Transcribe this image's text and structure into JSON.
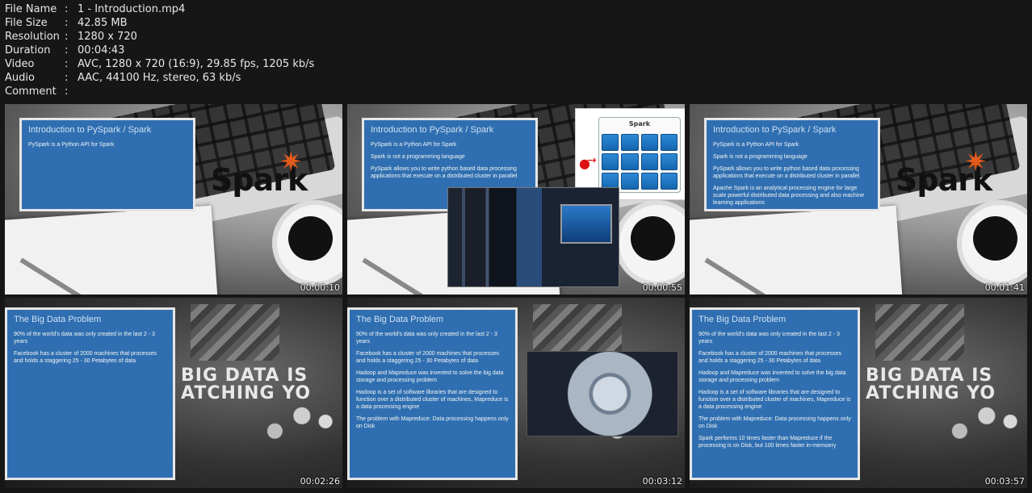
{
  "file_info": {
    "rows": [
      {
        "key": "File Name",
        "value": "1 - Introduction.mp4"
      },
      {
        "key": "File Size",
        "value": "42.85 MB"
      },
      {
        "key": "Resolution",
        "value": "1280 x 720"
      },
      {
        "key": "Duration",
        "value": "00:04:43"
      },
      {
        "key": "Video",
        "value": "AVC, 1280 x 720 (16:9), 29.85 fps, 1205 kb/s"
      },
      {
        "key": "Audio",
        "value": "AAC, 44100 Hz, stereo, 63 kb/s"
      },
      {
        "key": "Comment",
        "value": ""
      }
    ],
    "separator": ":"
  },
  "thumbnails": [
    {
      "timestamp": "00:00:10",
      "slide_title": "Introduction to PySpark / Spark",
      "lines": [
        "PySpark is a Python API for Spark"
      ],
      "logo_text": "Spark"
    },
    {
      "timestamp": "00:00:55",
      "slide_title": "Introduction to PySpark / Spark",
      "lines": [
        "PySpark is a Python API for Spark",
        "Spark is not a programming language",
        "PySpark allows you to write python based data processing applications that execute on a distributed cluster in parallel"
      ],
      "cluster_label": "Spark"
    },
    {
      "timestamp": "00:01:41",
      "slide_title": "Introduction to PySpark / Spark",
      "lines": [
        "PySpark is a Python API for Spark",
        "Spark is not a programming language",
        "PySpark allows you to write python based data processing applications that execute on a distributed cluster in parallel",
        "Apache Spark is an analytical processing engine for large scale powerful distributed data processing and also machine learning applications"
      ],
      "logo_text": "Spark"
    },
    {
      "timestamp": "00:02:26",
      "slide_title": "The Big Data Problem",
      "lines": [
        "90% of the world's data was only created in the last 2 - 3 years",
        "Facebook has a cluster of 2000 machines that processes and holds a staggering 25 - 30 Petabytes of data"
      ],
      "bg_text_1": "BIG DATA IS",
      "bg_text_2": "ATCHING YO"
    },
    {
      "timestamp": "00:03:12",
      "slide_title": "The Big Data Problem",
      "lines": [
        "90% of the world's data was only created in the last 2 - 3 years",
        "Facebook has a cluster of 2000 machines that processes and holds a staggering 25 - 30 Petabytes of data",
        "Hadoop and Mapreduce was invented to solve the big data storage and processing problem",
        "Hadoop is a set of software libraries that are designed to function over a distributed cluster of machines, Mapreduce is a data processing engine",
        "The problem with Mapreduce: Data processing happens only on Disk"
      ]
    },
    {
      "timestamp": "00:03:57",
      "slide_title": "The Big Data Problem",
      "lines": [
        "90% of the world's data was only created in the last 2 - 3 years",
        "Facebook has a cluster of 2000 machines that processes and holds a staggering 25 - 30 Petabytes of data",
        "Hadoop and Mapreduce was invented to solve the big data storage and processing problem",
        "Hadoop is a set of software libraries that are designed to function over a distributed cluster of machines, Mapreduce is a data processing engine",
        "The problem with Mapreduce: Data processing happens only on Disk",
        "Spark performs 10 times faster than Mapreduce if the processing is on Disk, but 100 times faster in-memoery"
      ],
      "bg_text_1": "BIG DATA IS",
      "bg_text_2": "ATCHING YO"
    }
  ],
  "colors": {
    "slide_blue": "#2f6fb1",
    "background": "#161616",
    "spark_orange": "#e25a1c"
  }
}
